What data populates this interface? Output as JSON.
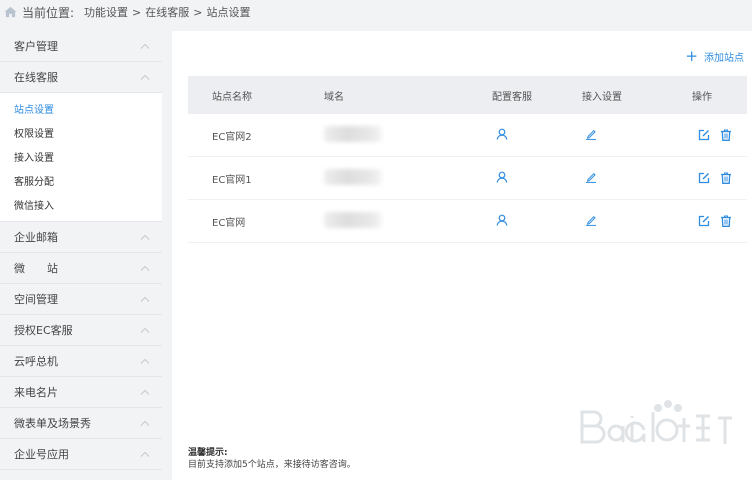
{
  "breadcrumb": {
    "current_position_label": "当前位置:",
    "items": [
      "功能设置",
      ">",
      "在线客服",
      ">",
      "站点设置"
    ]
  },
  "sidebar": {
    "sections_top": [
      {
        "label": "客户管理"
      },
      {
        "label": "在线客服"
      }
    ],
    "sub_items": [
      {
        "label": "站点设置",
        "active": true
      },
      {
        "label": "权限设置"
      },
      {
        "label": "接入设置"
      },
      {
        "label": "客服分配"
      },
      {
        "label": "微信接入"
      }
    ],
    "sections_bottom": [
      {
        "label": "企业邮箱"
      },
      {
        "label": "微　　站"
      },
      {
        "label": "空间管理"
      },
      {
        "label": "授权EC客服"
      },
      {
        "label": "云呼总机"
      },
      {
        "label": "来电名片"
      },
      {
        "label": "微表单及场景秀"
      },
      {
        "label": "企业号应用"
      }
    ]
  },
  "main": {
    "add_label": "添加站点",
    "table": {
      "headers": [
        "站点名称",
        "域名",
        "配置客服",
        "接入设置",
        "操作"
      ],
      "rows": [
        {
          "name": "EC官网2"
        },
        {
          "name": "EC官网1"
        },
        {
          "name": "EC官网"
        }
      ]
    },
    "tips_title": "温馨提示:",
    "tips_text": "目前支持添加5个站点，来接待访客咨询。"
  },
  "colors": {
    "accent": "#2f8ce1",
    "sidebar_bg": "#f1f3f5",
    "table_header_bg": "#eceef1"
  },
  "icons": {
    "home": "home-icon",
    "add": "plus-icon",
    "chevron": "chevron-up-icon",
    "config_service": "user-icon",
    "access_setting": "pencil-icon",
    "edit": "edit-icon",
    "delete": "trash-icon"
  }
}
